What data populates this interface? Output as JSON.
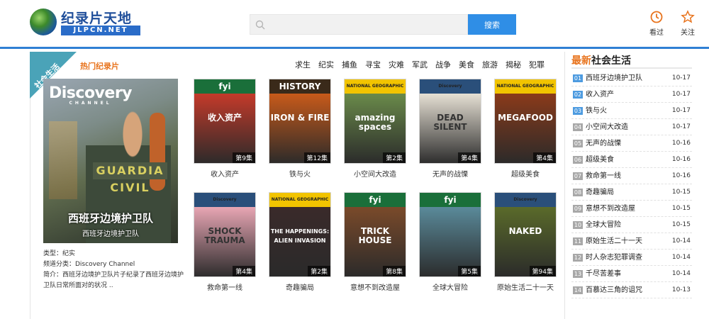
{
  "header": {
    "logo_title": "纪录片天地",
    "logo_subtitle": "JLPCN.NET",
    "search_placeholder": "",
    "search_button": "搜索",
    "history_label": "看过",
    "follow_label": "关注",
    "accent_color": "#2f7fd4"
  },
  "section": {
    "ribbon": "社会生活",
    "hot_title": "热门纪录片",
    "categories": [
      "求生",
      "纪实",
      "捕鱼",
      "寻宝",
      "灾难",
      "军武",
      "战争",
      "美食",
      "旅游",
      "揭秘",
      "犯罪"
    ]
  },
  "feature": {
    "brand": "Discovery",
    "brand_sub": "CHANNEL",
    "vest_text": "GUARDIA CIVIL",
    "title_big": "西班牙边境护卫队",
    "title_small": "西班牙边境护卫队",
    "type_line": "类型：纪实",
    "channel_line": "频道分类：Discovery Channel",
    "summary_line": "简介：西班牙边境护卫队片子纪录了西班牙边境护卫队日常所面对的状况 .."
  },
  "cards": [
    {
      "title": "收入资产",
      "episode": "第9集",
      "brand": "fyi",
      "label": "收入资产",
      "top_color": "#1a6f3a",
      "art": "#c43a2a"
    },
    {
      "title": "铁与火",
      "episode": "第12集",
      "brand": "HISTORY",
      "label": "IRON & FIRE",
      "top_color": "#3a2a1a",
      "art": "#c85a1a"
    },
    {
      "title": "小空间大改造",
      "episode": "第2集",
      "brand": "NATIONAL GEOGRAPHIC",
      "label": "amazing spaces",
      "top_color": "#f2c400",
      "art": "#6a8a4a"
    },
    {
      "title": "无声的战慄",
      "episode": "第4集",
      "brand": "Discovery",
      "label": "DEAD SILENT",
      "top_color": "#2a4f7a",
      "art": "#e6e0d4"
    },
    {
      "title": "超级美食",
      "episode": "第4集",
      "brand": "NATIONAL GEOGRAPHIC",
      "label": "MEGAFOOD",
      "top_color": "#f2c400",
      "art": "#8a3a1a"
    },
    {
      "title": "救命第一线",
      "episode": "第4集",
      "brand": "Discovery",
      "label": "SHOCK TRAUMA",
      "top_color": "#2a4f7a",
      "art": "#e8a6b4"
    },
    {
      "title": "奇趣骗局",
      "episode": "第2集",
      "brand": "NATIONAL GEOGRAPHIC",
      "label": "THE HAPPENINGS: ALIEN INVASION",
      "top_color": "#f2c400",
      "art": "#3a2a2a"
    },
    {
      "title": "意想不到改造屋",
      "episode": "第8集",
      "brand": "fyi",
      "label": "TRICK HOUSE",
      "top_color": "#1a6f3a",
      "art": "#7a4a2a"
    },
    {
      "title": "全球大冒险",
      "episode": "第5集",
      "brand": "fyi",
      "label": "",
      "top_color": "#1a6f3a",
      "art": "#5a8a9a"
    },
    {
      "title": "原始生活二十一天",
      "episode": "第94集",
      "brand": "Discovery",
      "label": "NAKED",
      "top_color": "#2a4f7a",
      "art": "#5a6a2a"
    }
  ],
  "side": {
    "title_highlight": "最新",
    "title_rest": "社会生活",
    "items": [
      {
        "num": "01",
        "title": "西班牙边境护卫队",
        "date": "10-17"
      },
      {
        "num": "02",
        "title": "收入资产",
        "date": "10-17"
      },
      {
        "num": "03",
        "title": "铁与火",
        "date": "10-17"
      },
      {
        "num": "04",
        "title": "小空间大改造",
        "date": "10-17"
      },
      {
        "num": "05",
        "title": "无声的战慄",
        "date": "10-16"
      },
      {
        "num": "06",
        "title": "超级美食",
        "date": "10-16"
      },
      {
        "num": "07",
        "title": "救命第一线",
        "date": "10-16"
      },
      {
        "num": "08",
        "title": "奇趣骗局",
        "date": "10-15"
      },
      {
        "num": "09",
        "title": "意想不到改造屋",
        "date": "10-15"
      },
      {
        "num": "10",
        "title": "全球大冒险",
        "date": "10-15"
      },
      {
        "num": "11",
        "title": "原始生活二十一天",
        "date": "10-14"
      },
      {
        "num": "12",
        "title": "时人杂志犯罪调查",
        "date": "10-14"
      },
      {
        "num": "13",
        "title": "千尽苦差事",
        "date": "10-14"
      },
      {
        "num": "14",
        "title": "百慕达三角的诅咒",
        "date": "10-13"
      }
    ]
  }
}
